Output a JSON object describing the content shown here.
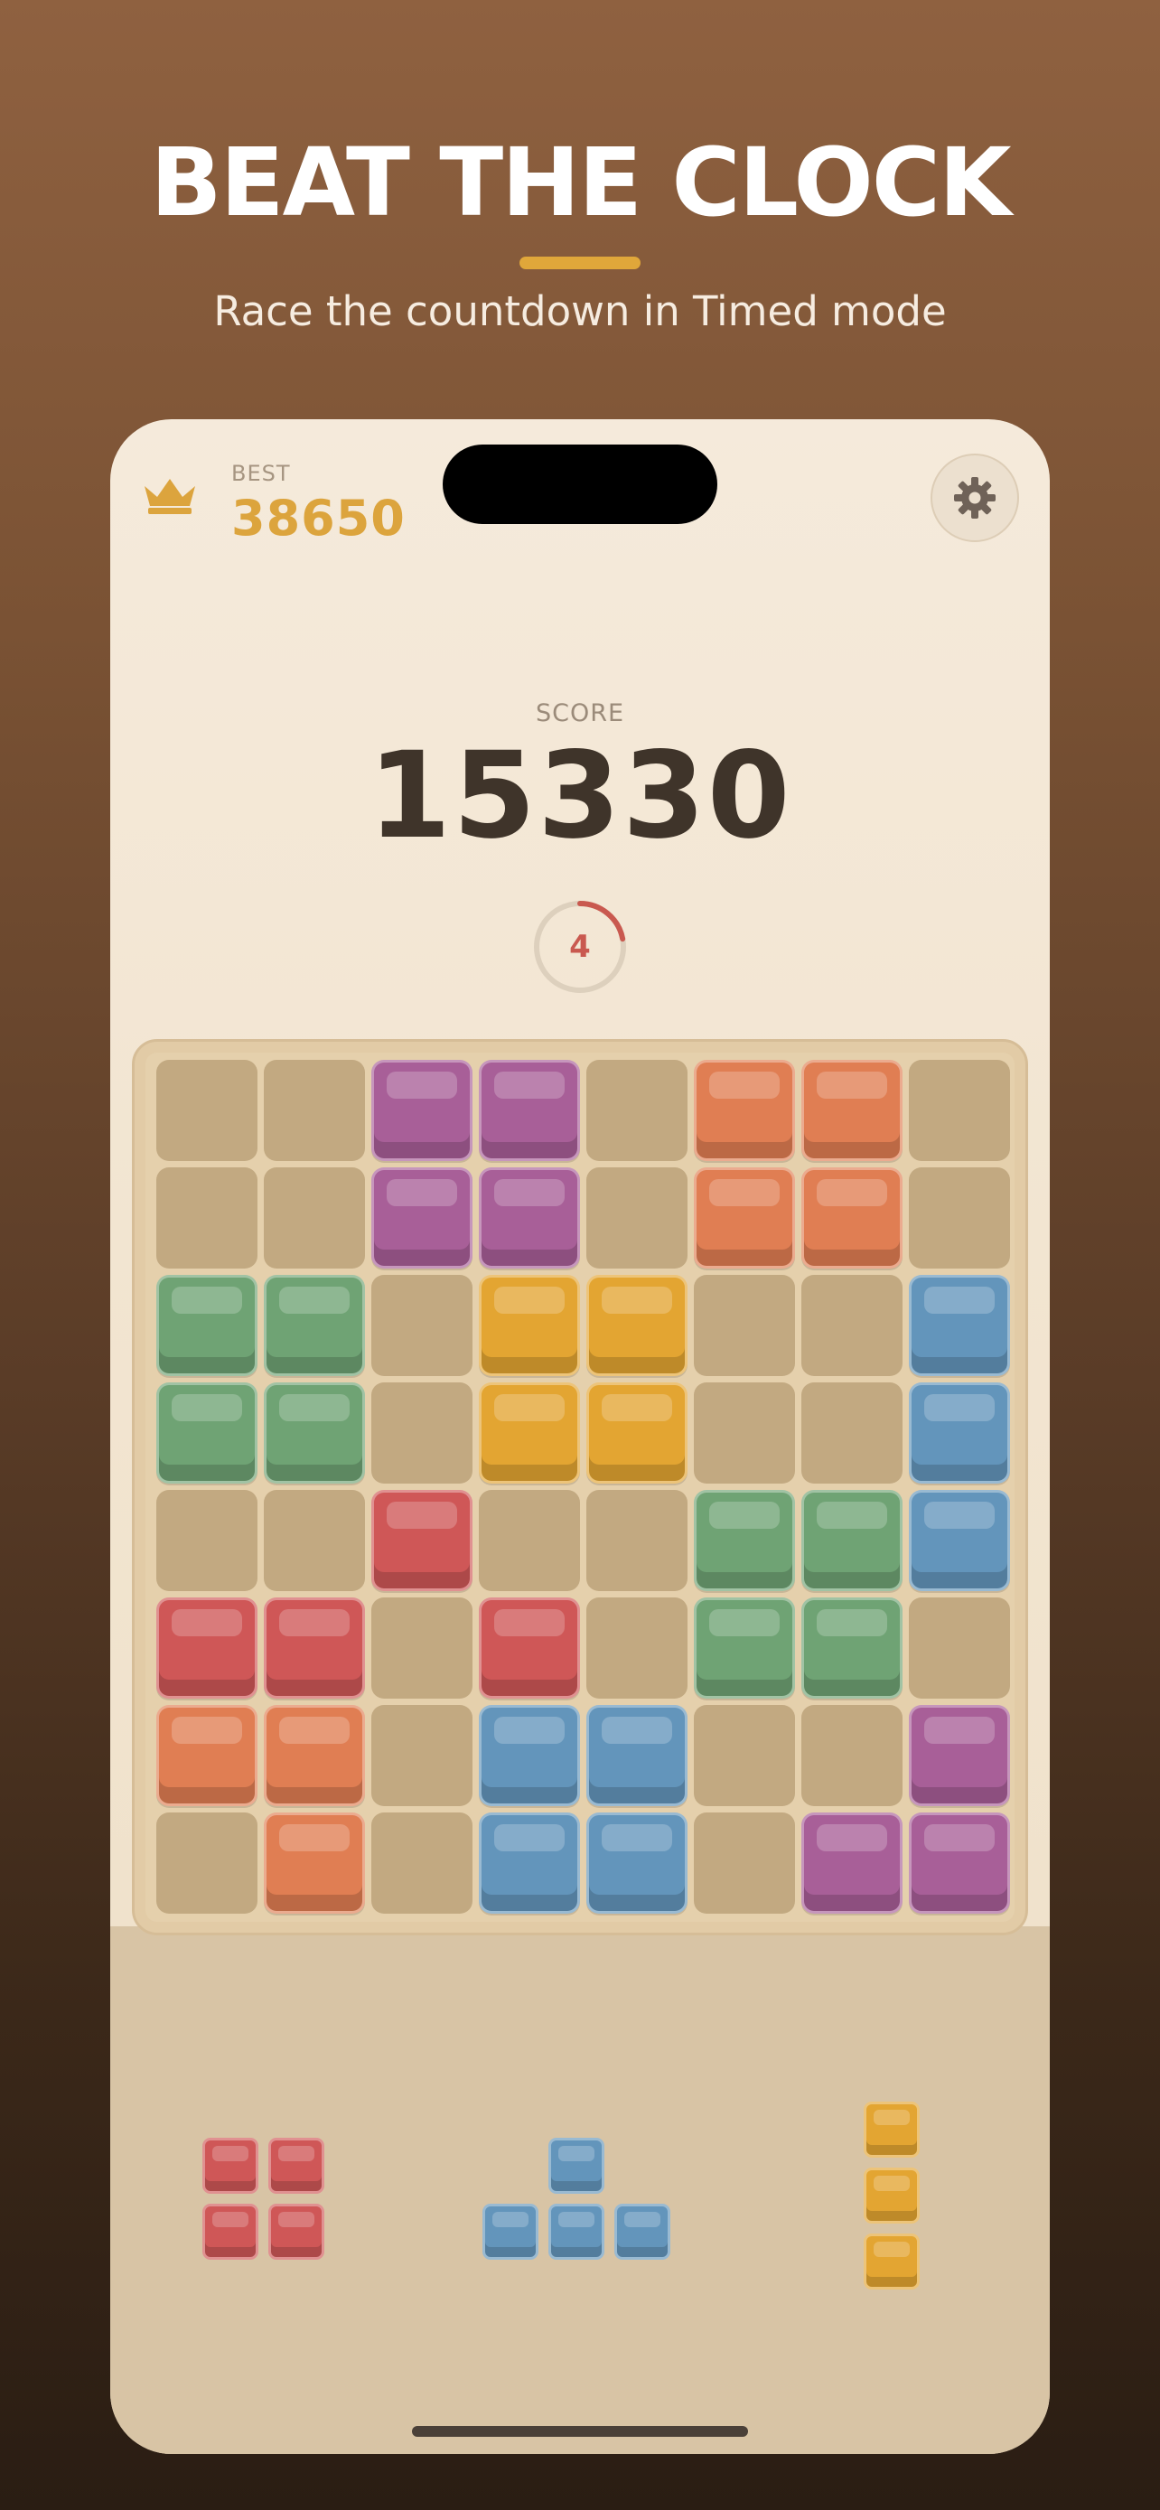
{
  "promo": {
    "headline": "BEAT THE CLOCK",
    "subheadline": "Race the countdown in Timed mode"
  },
  "header": {
    "best_label": "BEST",
    "best_value": "38650",
    "crown_icon": "crown-icon",
    "settings_icon": "gear-icon"
  },
  "score": {
    "label": "SCORE",
    "value": "15330"
  },
  "timer": {
    "seconds_left": "4",
    "progress_fraction": 0.22
  },
  "colors": {
    "empty": "#c2a981",
    "purple": "#a85f98",
    "orange": "#e07e53",
    "green": "#6fa374",
    "yellow": "#e3a532",
    "blue": "#6395bb",
    "red": "#cf5757",
    "accent": "#dca43d"
  },
  "board": {
    "size": 8,
    "rows": [
      [
        "empty",
        "empty",
        "purple",
        "purple",
        "empty",
        "orange",
        "orange",
        "empty"
      ],
      [
        "empty",
        "empty",
        "purple",
        "purple",
        "empty",
        "orange",
        "orange",
        "empty"
      ],
      [
        "green",
        "green",
        "empty",
        "yellow",
        "yellow",
        "empty",
        "empty",
        "blue"
      ],
      [
        "green",
        "green",
        "empty",
        "yellow",
        "yellow",
        "empty",
        "empty",
        "blue"
      ],
      [
        "empty",
        "empty",
        "red",
        "empty",
        "empty",
        "green",
        "green",
        "blue"
      ],
      [
        "red",
        "red",
        "empty",
        "red",
        "empty",
        "green",
        "green",
        "empty"
      ],
      [
        "orange",
        "orange",
        "empty",
        "blue",
        "blue",
        "empty",
        "empty",
        "purple"
      ],
      [
        "empty",
        "orange",
        "empty",
        "blue",
        "blue",
        "empty",
        "purple",
        "purple"
      ]
    ]
  },
  "tray": {
    "pieces": [
      {
        "name": "square-piece",
        "color": "red",
        "cells": [
          [
            0,
            0
          ],
          [
            0,
            1
          ],
          [
            1,
            0
          ],
          [
            1,
            1
          ]
        ]
      },
      {
        "name": "t-piece",
        "color": "blue",
        "cells": [
          [
            0,
            1
          ],
          [
            1,
            0
          ],
          [
            1,
            1
          ],
          [
            1,
            2
          ]
        ]
      },
      {
        "name": "vertical-i-piece",
        "color": "yellow",
        "cells": [
          [
            0,
            0
          ],
          [
            1,
            0
          ],
          [
            2,
            0
          ]
        ]
      }
    ]
  }
}
